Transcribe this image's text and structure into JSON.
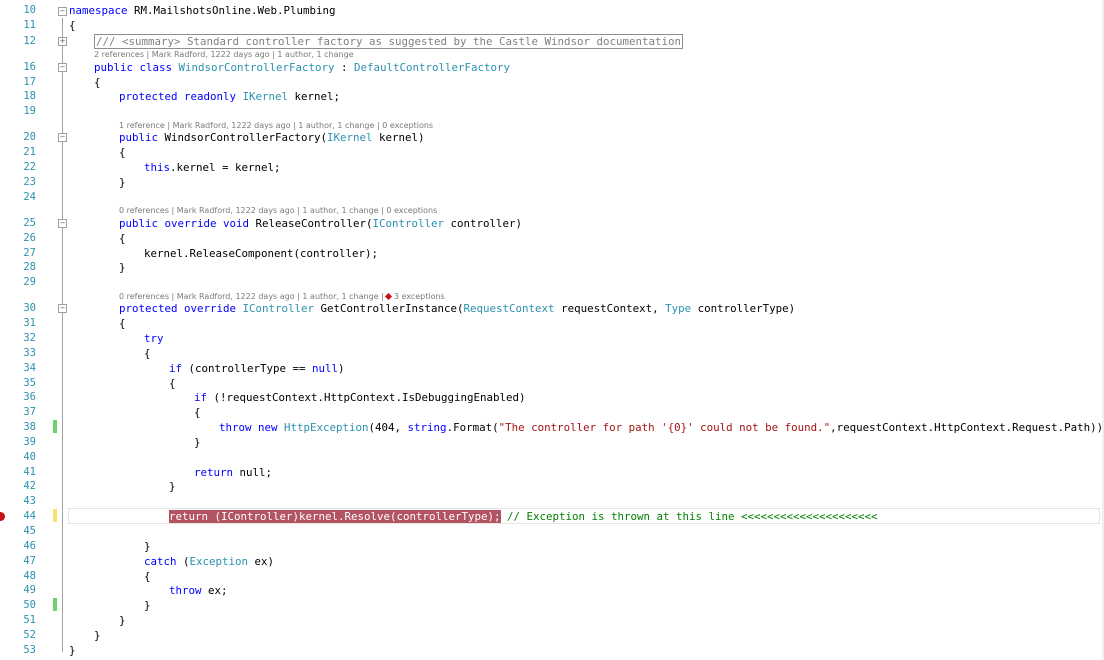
{
  "line_numbers": [
    "10",
    "11",
    "12",
    "16",
    "17",
    "18",
    "19",
    "20",
    "21",
    "22",
    "23",
    "24",
    "25",
    "26",
    "27",
    "28",
    "29",
    "30",
    "31",
    "32",
    "33",
    "34",
    "35",
    "36",
    "37",
    "38",
    "39",
    "40",
    "41",
    "42",
    "43",
    "44",
    "45",
    "46",
    "47",
    "48",
    "49",
    "50",
    "51",
    "52",
    "53"
  ],
  "code": {
    "namespace_kw": "namespace",
    "namespace_name": " RM.MailshotsOnline.Web.Plumbing",
    "open_brace": "{",
    "close_brace": "}",
    "summary": "/// <summary> Standard controller factory as suggested by the Castle Windsor documentation",
    "class_lens": "2 references | Mark Radford, 1222 days ago | 1 author, 1 change",
    "class_kw": "public class ",
    "class_name": "WindsorControllerFactory",
    "class_sep": " : ",
    "class_base": "DefaultControllerFactory",
    "field_kw": "protected readonly ",
    "field_type": "IKernel",
    "field_name": " kernel;",
    "ctor_lens": "1 reference | Mark Radford, 1222 days ago | 1 author, 1 change | 0 exceptions",
    "ctor_kw": "public ",
    "ctor_name": "WindsorControllerFactory(",
    "ctor_ptype": "IKernel",
    "ctor_pname": " kernel)",
    "this_kw": "this",
    "ctor_body": ".kernel = kernel;",
    "release_lens": "0 references | Mark Radford, 1222 days ago | 1 author, 1 change | 0 exceptions",
    "release_kw": "public override void ",
    "release_name": "ReleaseController(",
    "release_ptype": "IController",
    "release_pname": " controller)",
    "release_body": "kernel.ReleaseComponent(controller);",
    "get_lens_a": "0 references | Mark Radford, 1222 days ago | 1 author, 1 change |",
    "get_lens_b": "3 exceptions",
    "get_kw": "protected override ",
    "get_rtype": "IController",
    "get_name": " GetControllerInstance(",
    "get_p1type": "RequestContext",
    "get_p1name": " requestContext, ",
    "get_p2type": "Type",
    "get_p2name": " controllerType)",
    "try_kw": "try",
    "if1_kw": "if",
    "if1_cond": " (controllerType == ",
    "null_kw": "null",
    "if1_end": ")",
    "if2_kw": "if",
    "if2_cond": " (!requestContext.HttpContext.IsDebuggingEnabled)",
    "throw_kw": "throw new ",
    "throw_type": "HttpException",
    "throw_a": "(404, ",
    "string_kw": "string",
    "throw_b": ".Format(",
    "throw_str": "\"The controller for path '{0}' could not be found.\"",
    "throw_c": ",requestContext.HttpContext.Request.Path));",
    "return_kw": "return",
    "return_null": " null;",
    "resolve_stmt": "return (IController)kernel.Resolve(controllerType);",
    "resolve_comment": " // Exception is thrown at this line <<<<<<<<<<<<<<<<<<<<<",
    "catch_kw": "catch",
    "catch_a": " (",
    "catch_type": "Exception",
    "catch_b": " ex)",
    "throw2_kw": "throw",
    "throw2_rest": " ex;"
  },
  "colors": {
    "keyword": "#0000ff",
    "type": "#2b91af",
    "string": "#a31515",
    "comment": "#008000",
    "highlight": "#b25461",
    "change_saved": "#6bd36b",
    "change_unsaved": "#f5e26b",
    "breakpoint": "#c41010"
  }
}
